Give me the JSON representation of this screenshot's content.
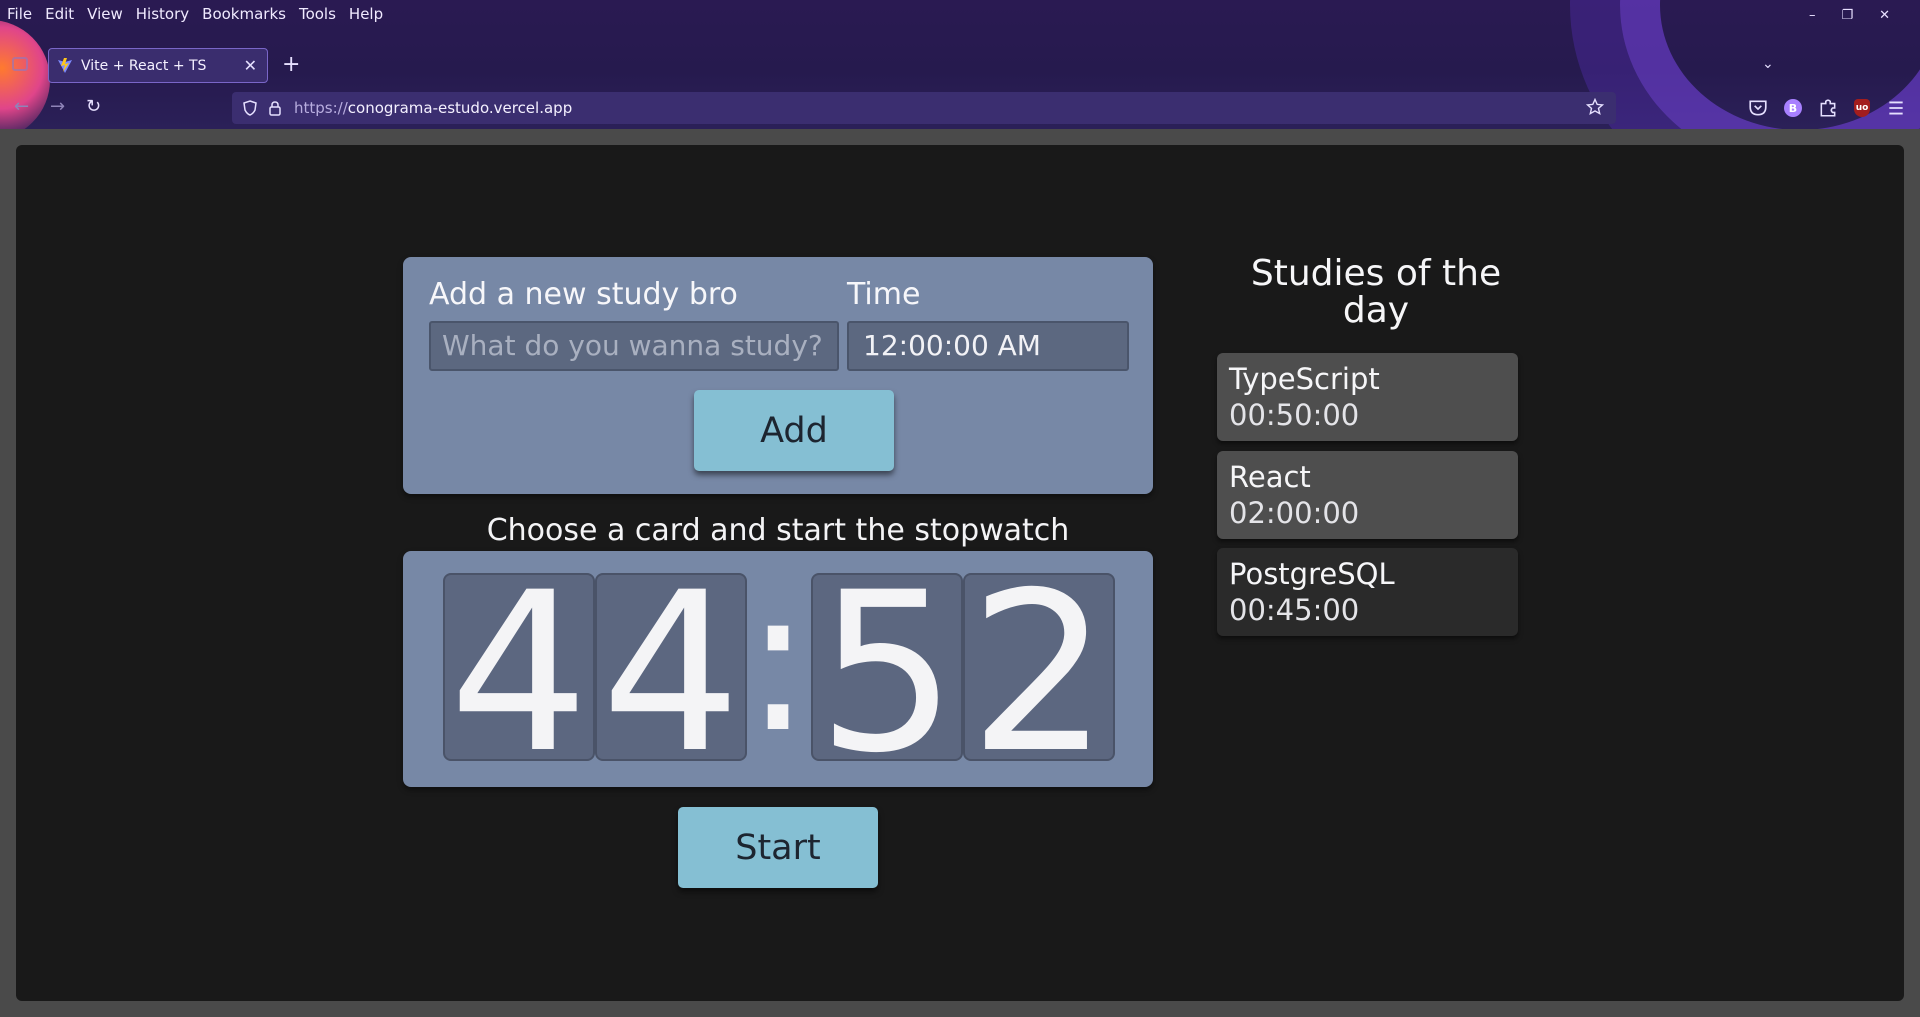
{
  "menu": [
    "File",
    "Edit",
    "View",
    "History",
    "Bookmarks",
    "Tools",
    "Help"
  ],
  "window_controls": {
    "minimize": "–",
    "restore": "❐",
    "close": "✕"
  },
  "tab": {
    "title": "Vite + React + TS",
    "close": "✕"
  },
  "toolbar": {
    "new_tab": "+",
    "tab_list": "⌄",
    "back": "←",
    "forward": "→",
    "reload": "↻"
  },
  "url": {
    "protocol": "https://",
    "host": "conograma-estudo.vercel.app"
  },
  "icons": {
    "shield": "shield-icon",
    "lock": "lock-icon",
    "star": "star-icon",
    "pocket": "pocket-icon",
    "extension_b": "B",
    "extensions": "puzzle-icon",
    "ublock": "uo",
    "menu": "hamburger-icon"
  },
  "add_form": {
    "title": "Add a new study bro",
    "time_label": "Time",
    "study_placeholder": "What do you wanna study?",
    "time_value": "12:00:00  AM",
    "add_label": "Add"
  },
  "stopwatch": {
    "prompt": "Choose a card and start the stopwatch",
    "digits": [
      "4",
      "4",
      "5",
      "2"
    ],
    "separator": ":",
    "start_label": "Start"
  },
  "studies": {
    "title": "Studies of the day",
    "items": [
      {
        "name": "TypeScript",
        "duration": "00:50:00"
      },
      {
        "name": "React",
        "duration": "02:00:00"
      },
      {
        "name": "PostgreSQL",
        "duration": "00:45:00"
      }
    ]
  },
  "colors": {
    "page_bg": "#191919",
    "card_bg": "#7788a6",
    "button_bg": "#85bfd3",
    "study_card_active": "#4e4e4e",
    "study_card_inactive": "#2a2a2a"
  }
}
